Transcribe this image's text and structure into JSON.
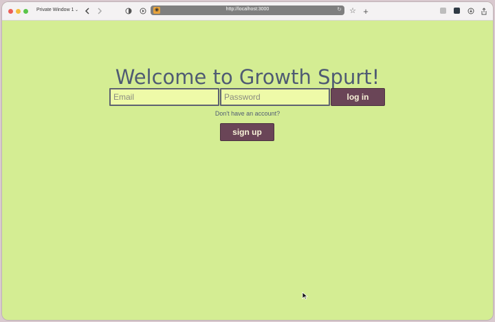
{
  "browser": {
    "window_label": "Private Window 1",
    "url": "http://localhost:3000",
    "icons": [
      "chevron-left-icon",
      "chevron-right-icon",
      "shield-icon",
      "play-circle-icon",
      "star-icon",
      "plus-icon",
      "download-icon",
      "share-icon"
    ]
  },
  "page": {
    "title": "Welcome to Growth Spurt!",
    "email_placeholder": "Email",
    "password_placeholder": "Password",
    "login_label": "log in",
    "no_account_text": "Don't have an account?",
    "signup_label": "sign up"
  },
  "colors": {
    "page_background": "#d4ed93",
    "input_background": "#eefaa8",
    "button_background": "#6a4557",
    "title_color": "#4f5b73"
  }
}
